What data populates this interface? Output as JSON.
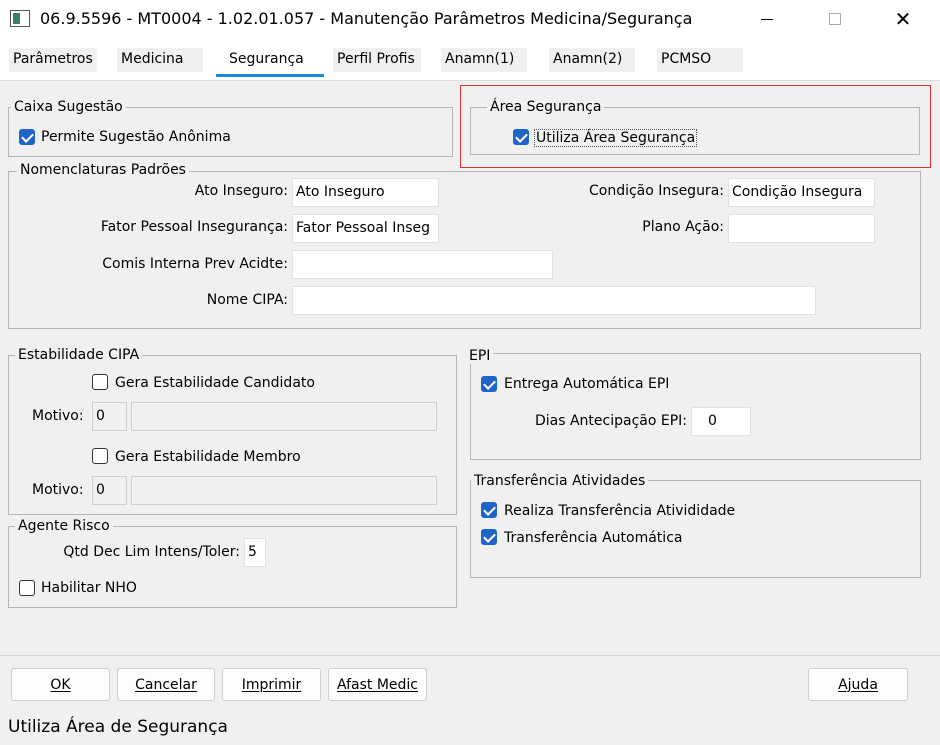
{
  "window": {
    "title": "06.9.5596 - MT0004 - 1.02.01.057 - Manutenção Parâmetros Medicina/Segurança",
    "minimize_glyph": "—",
    "close_glyph": "✕"
  },
  "tabs": [
    {
      "label": "Parâmetros"
    },
    {
      "label": "Medicina"
    },
    {
      "label": "Segurança"
    },
    {
      "label": "Perfil Profis"
    },
    {
      "label": "Anamn(1)"
    },
    {
      "label": "Anamn(2)"
    },
    {
      "label": "PCMSO"
    }
  ],
  "caixa_sugestao": {
    "title": "Caixa Sugestão",
    "permite_anonima": {
      "label": "Permite Sugestão Anônima",
      "checked": true
    }
  },
  "area_seguranca": {
    "title": "Área Segurança",
    "utiliza": {
      "label": "Utiliza Área Segurança",
      "checked": true
    }
  },
  "nomenclaturas": {
    "title": "Nomenclaturas Padrões",
    "ato_inseguro": {
      "label": "Ato Inseguro:",
      "value": "Ato Inseguro"
    },
    "condicao_insegura": {
      "label": "Condição Insegura:",
      "value": "Condição Insegura"
    },
    "fator_pessoal": {
      "label": "Fator Pessoal Insegurança:",
      "value": "Fator Pessoal Inseg"
    },
    "plano_acao": {
      "label": "Plano Ação:",
      "value": ""
    },
    "comis_interna": {
      "label": "Comis Interna Prev Acidte:",
      "value": ""
    },
    "nome_cipa": {
      "label": "Nome CIPA:",
      "value": ""
    }
  },
  "estabilidade_cipa": {
    "title": "Estabilidade CIPA",
    "gera_candidato": {
      "label": "Gera Estabilidade Candidato",
      "checked": false
    },
    "motivo1": {
      "label": "Motivo:",
      "code": "0",
      "desc": ""
    },
    "gera_membro": {
      "label": "Gera Estabilidade Membro",
      "checked": false
    },
    "motivo2": {
      "label": "Motivo:",
      "code": "0",
      "desc": ""
    }
  },
  "epi": {
    "title": "EPI",
    "entrega_automatica": {
      "label": "Entrega Automática EPI",
      "checked": true
    },
    "dias_antecipacao": {
      "label": "Dias Antecipação EPI:",
      "value": "0"
    }
  },
  "agente_risco": {
    "title": "Agente Risco",
    "qtd_dec": {
      "label": "Qtd Dec Lim Intens/Toler:",
      "value": "5"
    },
    "habilitar_nho": {
      "label": "Habilitar NHO",
      "checked": false
    }
  },
  "transferencia": {
    "title": "Transferência Atividades",
    "realiza": {
      "label": "Realiza Transferência Ativididade",
      "checked": true
    },
    "automatica": {
      "label": "Transferência Automática",
      "checked": true
    }
  },
  "buttons": {
    "ok": "OK",
    "cancelar": "Cancelar",
    "imprimir": "Imprimir",
    "afast_medic": "Afast Medic",
    "ajuda": "Ajuda"
  },
  "status": {
    "text": "Utiliza Área de Segurança"
  },
  "colors": {
    "accent": "#1e88e5",
    "checkbox": "#1f64c8",
    "highlight": "#dd3333"
  }
}
